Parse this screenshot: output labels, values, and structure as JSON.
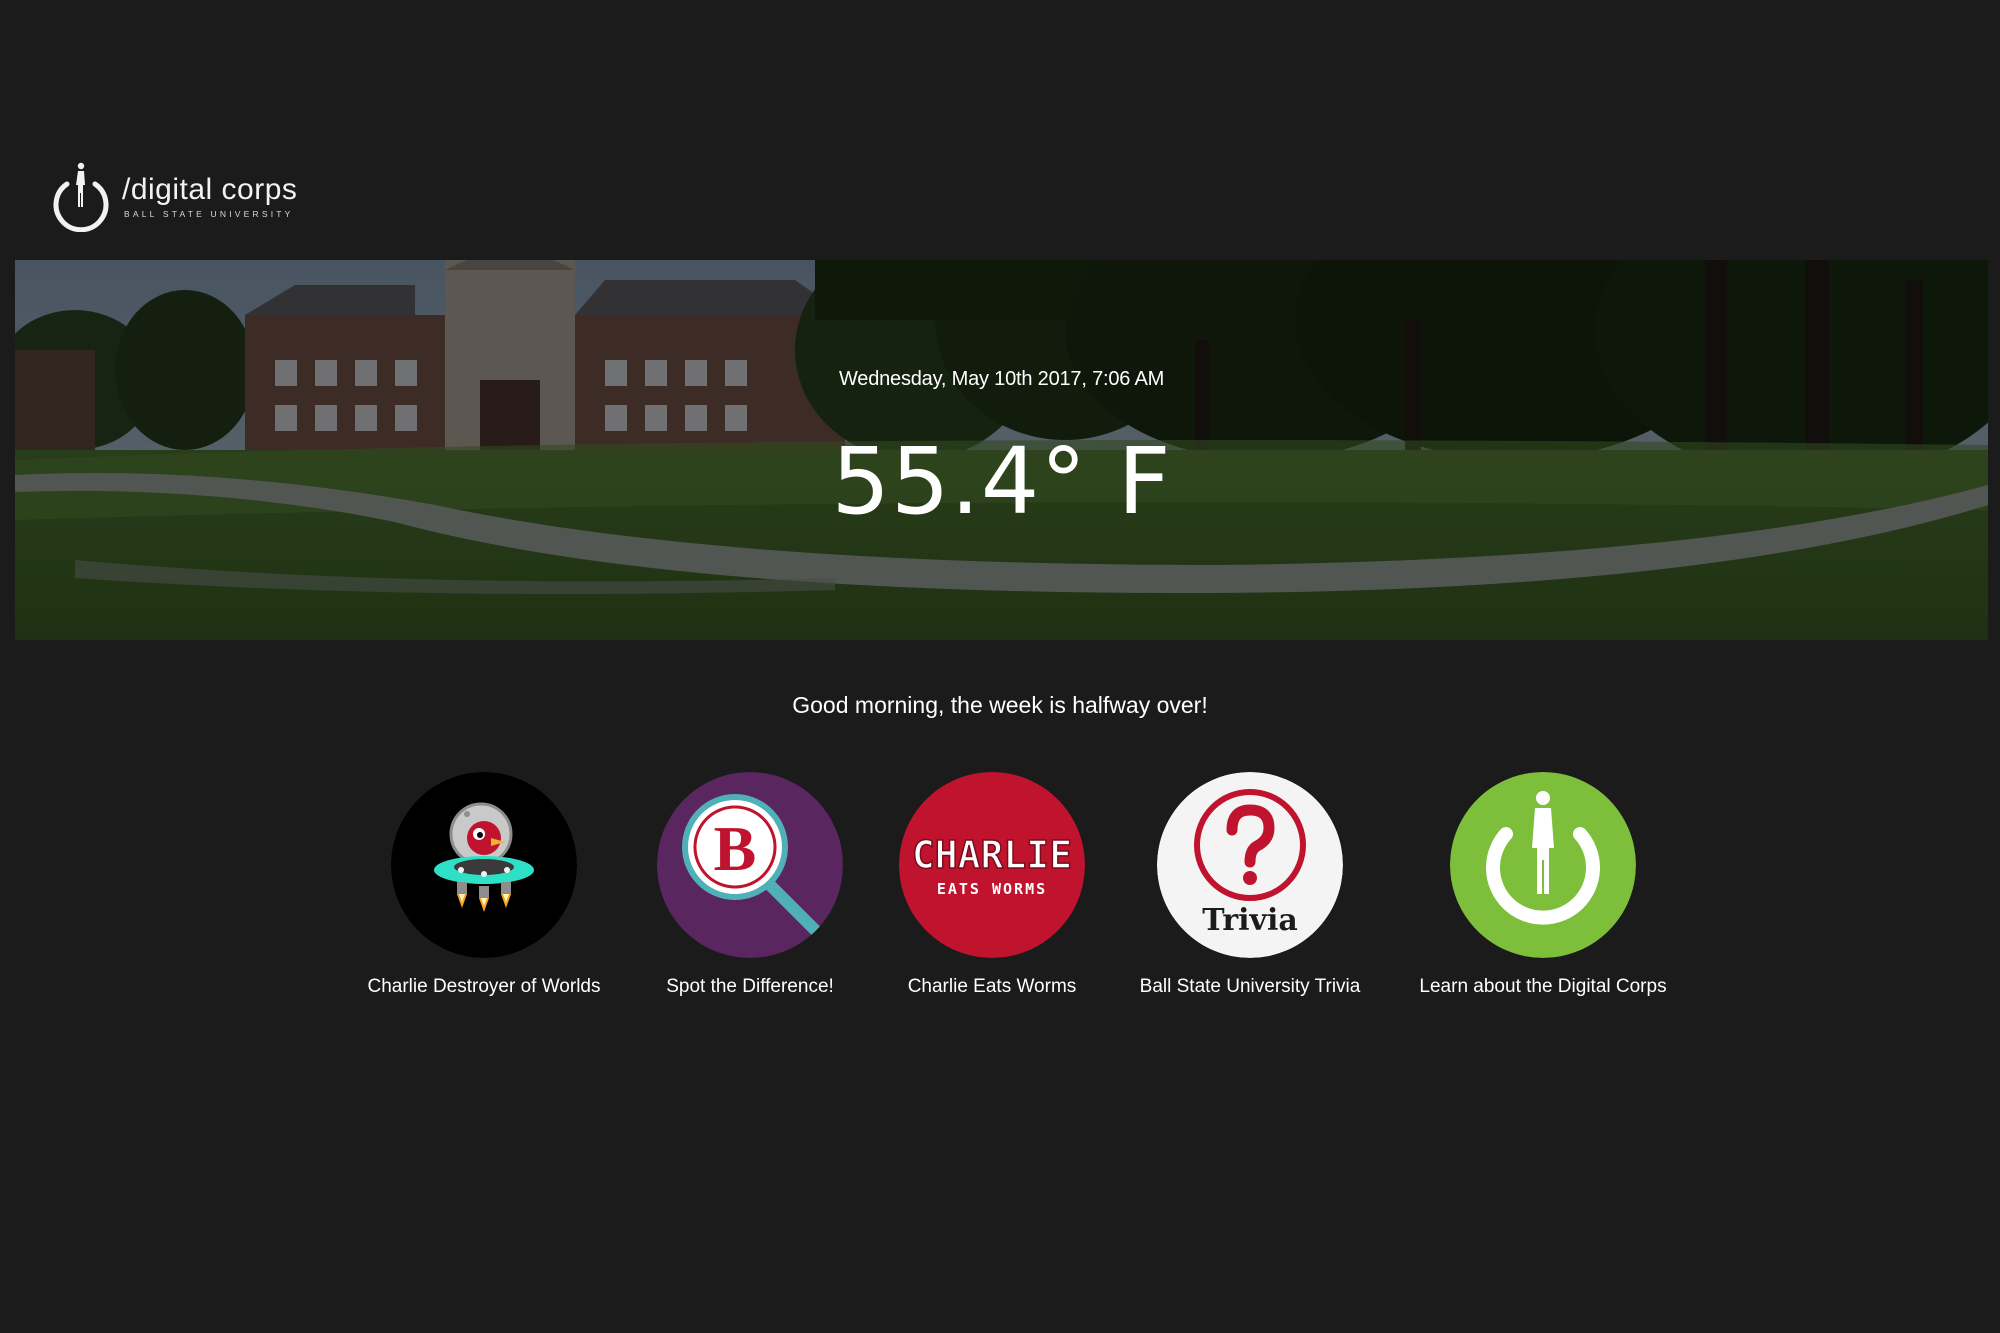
{
  "brand": {
    "name": "/digital corps",
    "subtitle": "BALL STATE UNIVERSITY"
  },
  "hero": {
    "datetime": "Wednesday, May 10th 2017, 7:06 AM",
    "temperature": "55.4° F"
  },
  "greeting": "Good morning, the week is halfway over!",
  "apps": [
    {
      "label": "Charlie Destroyer of Worlds",
      "icon": "charlie-spaceship-icon",
      "color": "#000000"
    },
    {
      "label": "Spot the Difference!",
      "icon": "magnifier-b-icon",
      "color": "#5a2660"
    },
    {
      "label": "Charlie Eats Worms",
      "icon": "charlie-eats-worms-logo",
      "color": "#c0132e",
      "logo_title": "CHARLIE",
      "logo_sub": "EATS WORMS"
    },
    {
      "label": "Ball State University Trivia",
      "icon": "trivia-question-icon",
      "color": "#f4f4f4",
      "logo_title": "Trivia"
    },
    {
      "label": "Learn about the Digital Corps",
      "icon": "power-person-icon",
      "color": "#7dbe3b"
    }
  ]
}
